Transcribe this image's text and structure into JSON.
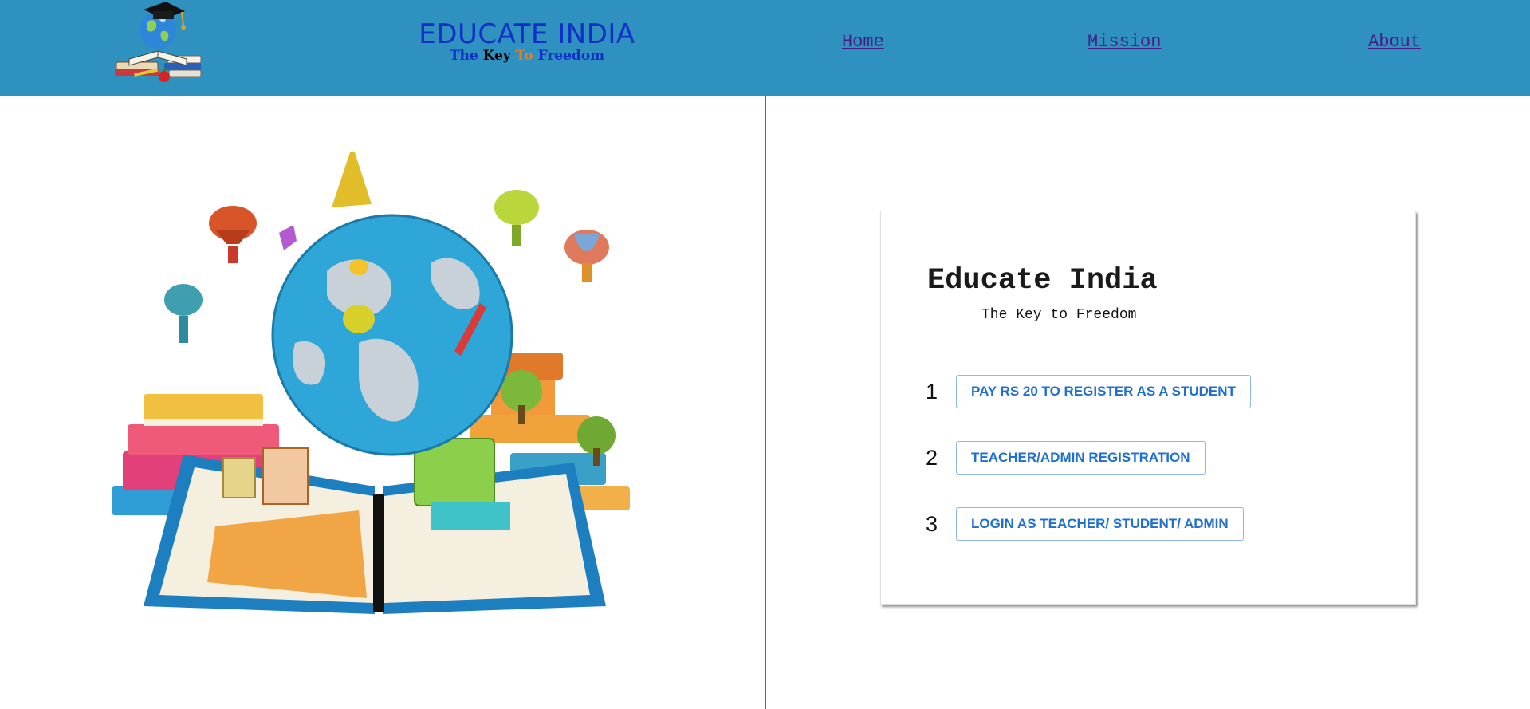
{
  "header": {
    "logo_icon": "graduation-globe-books-logo",
    "brand_title": "EDUCATE INDIA",
    "tagline": {
      "the": "The",
      "key": "Key",
      "to": "To",
      "freedom": "Freedom"
    },
    "nav": {
      "home": "Home",
      "mission": "Mission",
      "about": "About"
    },
    "colors": {
      "bar": "#2e91c0",
      "brand": "#0f2fc6",
      "accent": "#f07a1f",
      "link": "#4a1c8a"
    }
  },
  "hero": {
    "icon": "globe-books-balloons-illustration"
  },
  "card": {
    "title": "Educate India",
    "subtitle": "The Key to Freedom",
    "steps": [
      {
        "number": "1",
        "label": "PAY RS 20 TO REGISTER AS A STUDENT"
      },
      {
        "number": "2",
        "label": "TEACHER/ADMIN REGISTRATION"
      },
      {
        "number": "3",
        "label": "LOGIN AS TEACHER/ STUDENT/ ADMIN"
      }
    ],
    "colors": {
      "button_text": "#1f6fd1",
      "button_border": "#8fb7e4"
    }
  },
  "divider_color": "#2e8b3d"
}
